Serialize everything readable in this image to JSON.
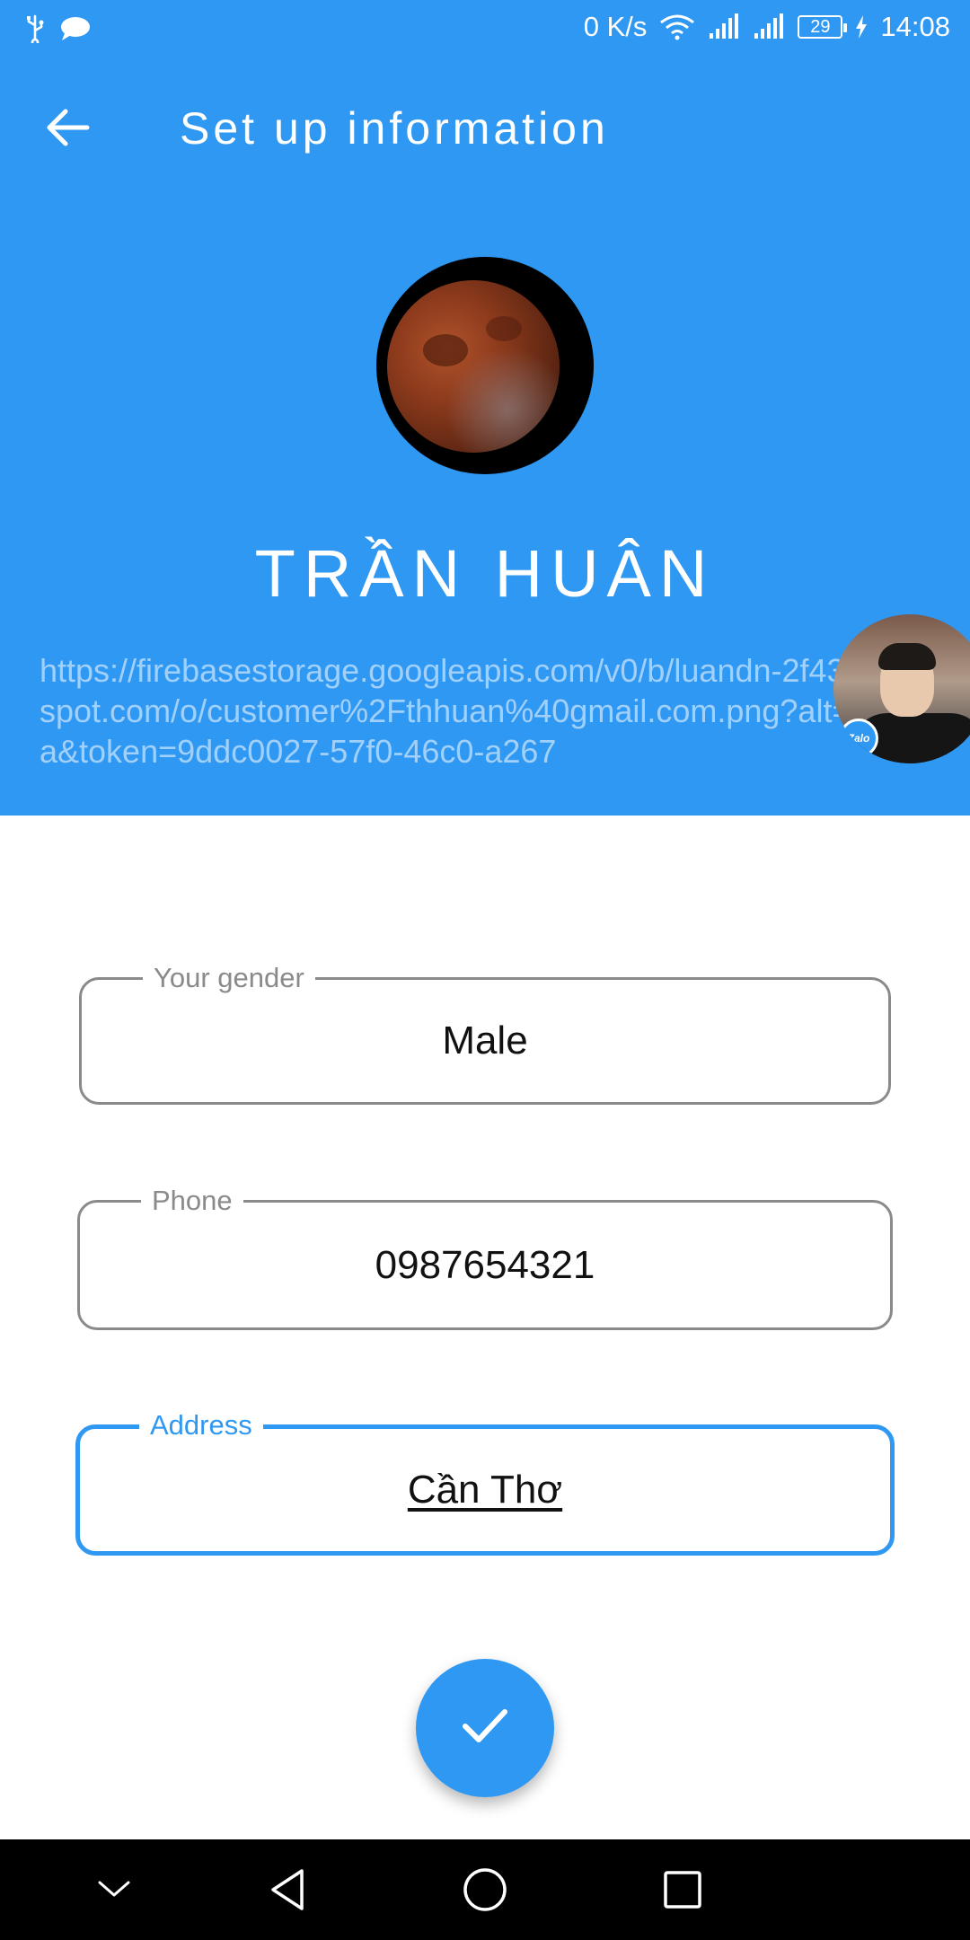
{
  "status_bar": {
    "speed": "0 K/s",
    "battery": "29",
    "time": "14:08",
    "icons": [
      "usb-icon",
      "chat-icon",
      "wifi-icon",
      "signal-icon",
      "signal-icon",
      "battery-icon",
      "charging-icon"
    ]
  },
  "app_bar": {
    "title": "Set up information",
    "back_icon": "arrow-left-icon"
  },
  "profile": {
    "name": "TRẦN HUÂN",
    "avatar_url": "https://firebasestorage.googleapis.com/v0/b/luandn-2f439.appspot.com/o/customer%2Fthhuan%40gmail.com.png?alt=media&token=9ddc0027-57f0-46c0-a267"
  },
  "zalo_bubble": {
    "badge": "Zalo"
  },
  "form": {
    "gender": {
      "label": "Your gender",
      "value": "Male"
    },
    "phone": {
      "label": "Phone",
      "value": "0987654321"
    },
    "address": {
      "label": "Address",
      "value": "Cần Thơ"
    }
  },
  "fab": {
    "icon": "check-icon"
  },
  "nav_bar": {
    "icons": [
      "chevron-down-icon",
      "back-triangle-icon",
      "home-circle-icon",
      "recents-square-icon"
    ]
  },
  "colors": {
    "primary": "#2f98f3",
    "outline": "#8a8a8a",
    "nav": "#000000"
  }
}
